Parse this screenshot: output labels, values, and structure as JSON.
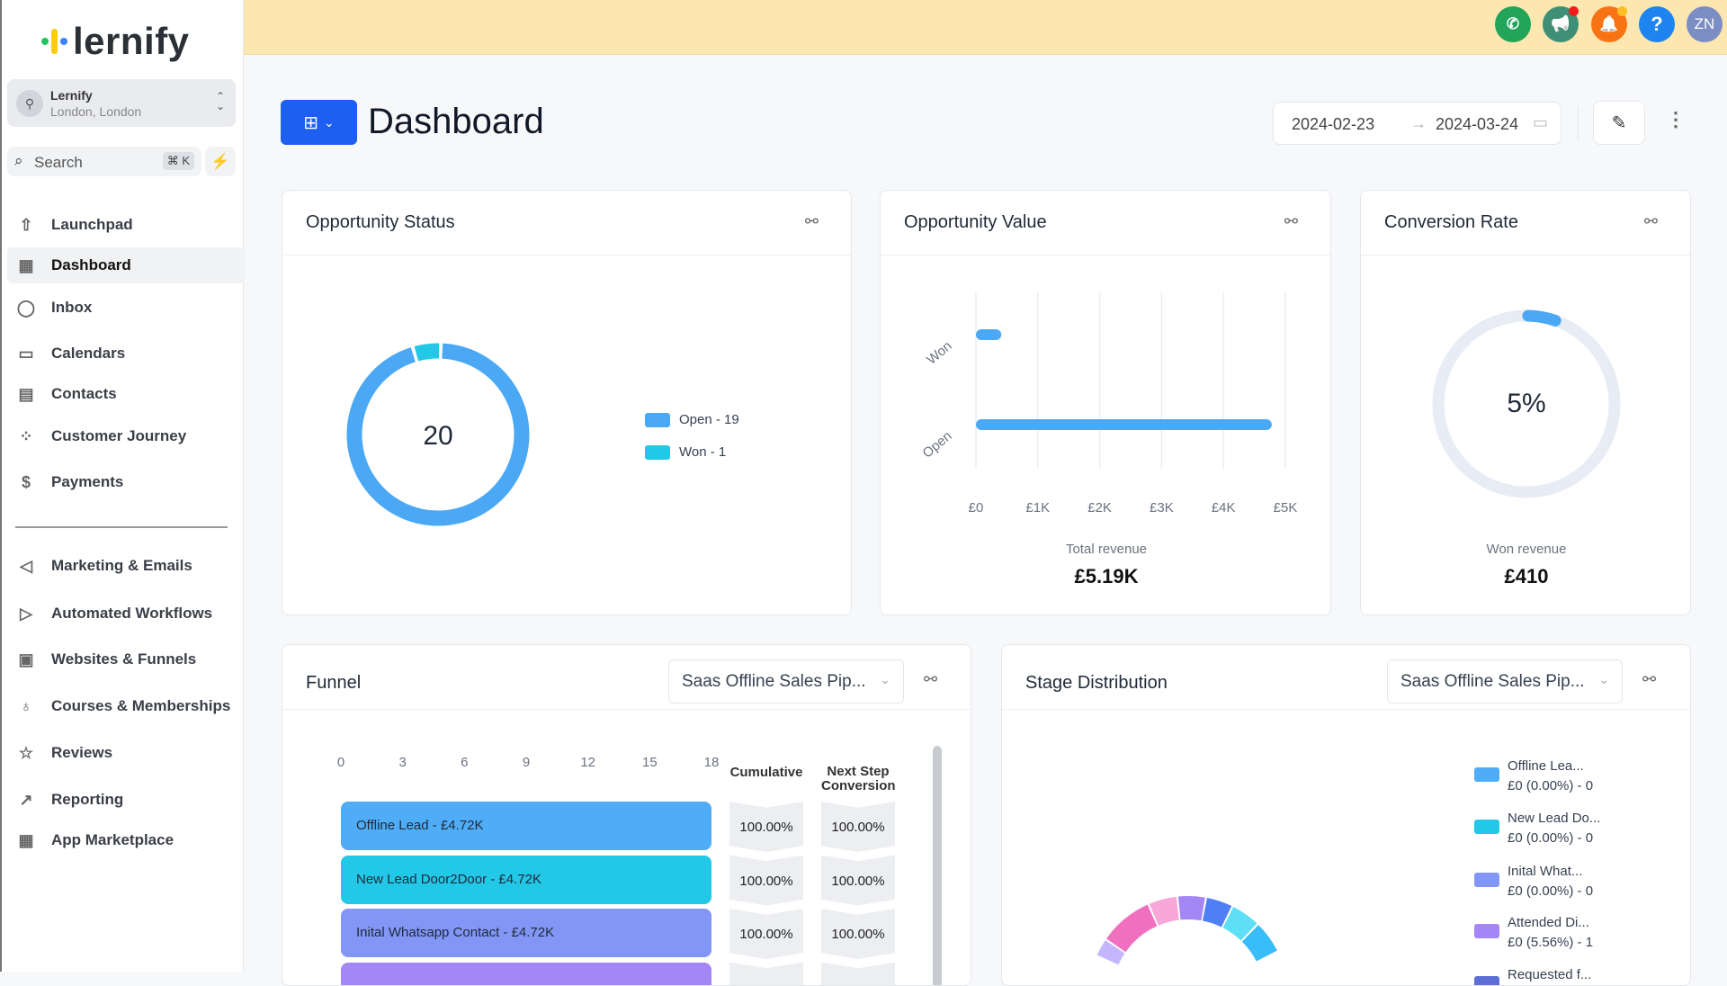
{
  "brand": {
    "name": "lernify",
    "colors": [
      "#22c55e",
      "#facc15",
      "#3b82f6"
    ]
  },
  "location": {
    "name": "Lernify",
    "address": "London, London"
  },
  "search": {
    "placeholder": "Search",
    "shortcut": "⌘ K"
  },
  "sidebar": {
    "items": [
      {
        "label": "Launchpad",
        "icon": "rocket-icon",
        "glyph": "⇧"
      },
      {
        "label": "Dashboard",
        "icon": "dashboard-icon",
        "glyph": "▦",
        "active": true
      },
      {
        "label": "Inbox",
        "icon": "chat-icon",
        "glyph": "◯"
      },
      {
        "label": "Calendars",
        "icon": "calendar-icon",
        "glyph": "▭"
      },
      {
        "label": "Contacts",
        "icon": "contacts-icon",
        "glyph": "▤"
      },
      {
        "label": "Customer Journey",
        "icon": "journey-icon",
        "glyph": "⁘"
      },
      {
        "label": "Payments",
        "icon": "payments-icon",
        "glyph": "$"
      },
      {
        "label": "Marketing & Emails",
        "icon": "send-icon",
        "glyph": "◁"
      },
      {
        "label": "Automated Workflows",
        "icon": "workflow-icon",
        "glyph": "▷"
      },
      {
        "label": "Websites & Funnels",
        "icon": "website-icon",
        "glyph": "▣"
      },
      {
        "label": "Courses & Memberships",
        "icon": "award-icon",
        "glyph": "♁"
      },
      {
        "label": "Reviews",
        "icon": "star-icon",
        "glyph": "☆"
      },
      {
        "label": "Reporting",
        "icon": "trend-icon",
        "glyph": "↗"
      },
      {
        "label": "App Marketplace",
        "icon": "apps-icon",
        "glyph": "▦"
      }
    ]
  },
  "topbar": {
    "buttons": [
      {
        "name": "phone",
        "icon": "phone-icon",
        "glyph": "✆",
        "color": "#22a55a"
      },
      {
        "name": "announcements",
        "icon": "megaphone-icon",
        "glyph": "📢",
        "color": "#3f8f76",
        "badge": "#ef1c1c"
      },
      {
        "name": "notifications",
        "icon": "bell-icon",
        "glyph": "🔔",
        "color": "#f77314",
        "badge": "#fbbf24"
      },
      {
        "name": "help",
        "icon": "help-icon",
        "glyph": "?",
        "color": "#1d84f0"
      }
    ],
    "avatar": {
      "initials": "ZN",
      "color": "#7b8ec4"
    }
  },
  "header": {
    "title": "Dashboard",
    "date_start": "2024-02-23",
    "date_end": "2024-03-24",
    "date_end_visible": "2024-03-2‹"
  },
  "cards": {
    "status": {
      "title": "Opportunity Status",
      "center": "20"
    },
    "value": {
      "title": "Opportunity Value",
      "footer_label": "Total revenue",
      "footer_value": "£5.19K"
    },
    "conversion": {
      "title": "Conversion Rate",
      "center": "5%",
      "footer_label": "Won revenue",
      "footer_value": "£410"
    },
    "funnel": {
      "title": "Funnel",
      "pipeline": "Saas Offline Sales Pip...",
      "col_cumulative": "Cumulative",
      "col_next": "Next Step Conversion"
    },
    "stage": {
      "title": "Stage Distribution",
      "pipeline": "Saas Offline Sales Pip..."
    }
  },
  "chart_data": [
    {
      "id": "status",
      "type": "pie",
      "donut": true,
      "series": [
        {
          "name": "Open - 19",
          "label": "Open",
          "value": 19,
          "color": "#4aa8f5"
        },
        {
          "name": "Won - 1",
          "label": "Won",
          "value": 1,
          "color": "#22c8e6"
        }
      ]
    },
    {
      "id": "value",
      "type": "bar",
      "orientation": "horizontal",
      "categories": [
        "Won",
        "Open"
      ],
      "values": [
        410,
        4780
      ],
      "xlim": [
        0,
        5000
      ],
      "xticks": [
        "£0",
        "£1K",
        "£2K",
        "£3K",
        "£4K",
        "£5K"
      ],
      "grid": true,
      "color": "#4aa8f5"
    },
    {
      "id": "conversion",
      "type": "pie",
      "donut": true,
      "value_percent": 5,
      "color": "#4aa8f5",
      "track": "#e8edf5"
    },
    {
      "id": "funnel",
      "type": "bar",
      "orientation": "horizontal",
      "xticks": [
        "0",
        "3",
        "6",
        "9",
        "12",
        "15",
        "18"
      ],
      "xlim": [
        0,
        18
      ],
      "rows": [
        {
          "label": "Offline Lead - £4.72K",
          "value": 18,
          "cumulative": "100.00%",
          "next": "100.00%",
          "color": "#4fadf7"
        },
        {
          "label": "New Lead Door2Door - £4.72K",
          "value": 18,
          "cumulative": "100.00%",
          "next": "100.00%",
          "color": "#22c8e6"
        },
        {
          "label": "Inital Whatsapp Contact - £4.72K",
          "value": 18,
          "cumulative": "100.00%",
          "next": "100.00%",
          "color": "#8297f5"
        },
        {
          "label": "",
          "value": 18,
          "color": "#a586f5"
        }
      ]
    },
    {
      "id": "stage",
      "type": "pie",
      "donut": true,
      "legend": [
        {
          "name": "Offline Lea...",
          "detail": "£0 (0.00%) - 0",
          "color": "#4fadf7"
        },
        {
          "name": "New Lead Do...",
          "detail": "£0 (0.00%) - 0",
          "color": "#22c8e6"
        },
        {
          "name": "Inital What...",
          "detail": "£0 (0.00%) - 0",
          "color": "#8297f5"
        },
        {
          "name": "Attended Di...",
          "detail": "£0 (5.56%) - 1",
          "color": "#a586f5"
        },
        {
          "name": "Requested f...",
          "detail": "",
          "color": "#5b6fd6"
        }
      ],
      "segment_colors": [
        "#c4b5fd",
        "#f06fbf",
        "#f7a8d8",
        "#a586f5",
        "#4f7ff5",
        "#5fdff5",
        "#38bdf8"
      ]
    }
  ]
}
